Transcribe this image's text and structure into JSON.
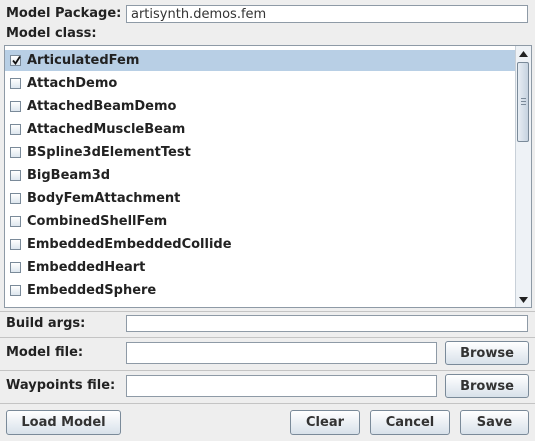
{
  "model_package": {
    "label": "Model Package:",
    "value": "artisynth.demos.fem"
  },
  "model_class": {
    "label": "Model class:",
    "items": [
      {
        "label": "ArticulatedFem",
        "checked": true,
        "selected": true
      },
      {
        "label": "AttachDemo",
        "checked": false,
        "selected": false
      },
      {
        "label": "AttachedBeamDemo",
        "checked": false,
        "selected": false
      },
      {
        "label": "AttachedMuscleBeam",
        "checked": false,
        "selected": false
      },
      {
        "label": "BSpline3dElementTest",
        "checked": false,
        "selected": false
      },
      {
        "label": "BigBeam3d",
        "checked": false,
        "selected": false
      },
      {
        "label": "BodyFemAttachment",
        "checked": false,
        "selected": false
      },
      {
        "label": "CombinedShellFem",
        "checked": false,
        "selected": false
      },
      {
        "label": "EmbeddedEmbeddedCollide",
        "checked": false,
        "selected": false
      },
      {
        "label": "EmbeddedHeart",
        "checked": false,
        "selected": false
      },
      {
        "label": "EmbeddedSphere",
        "checked": false,
        "selected": false
      }
    ]
  },
  "build_args": {
    "label": "Build args:",
    "value": ""
  },
  "model_file": {
    "label": "Model file:",
    "value": "",
    "browse_label": "Browse"
  },
  "waypoints_file": {
    "label": "Waypoints file:",
    "value": "",
    "browse_label": "Browse"
  },
  "buttons": {
    "load_model": "Load Model",
    "clear": "Clear",
    "cancel": "Cancel",
    "save": "Save"
  },
  "colors": {
    "selection": "#b8cfe5",
    "background": "#eeeeee",
    "border": "#8e9aa6"
  }
}
